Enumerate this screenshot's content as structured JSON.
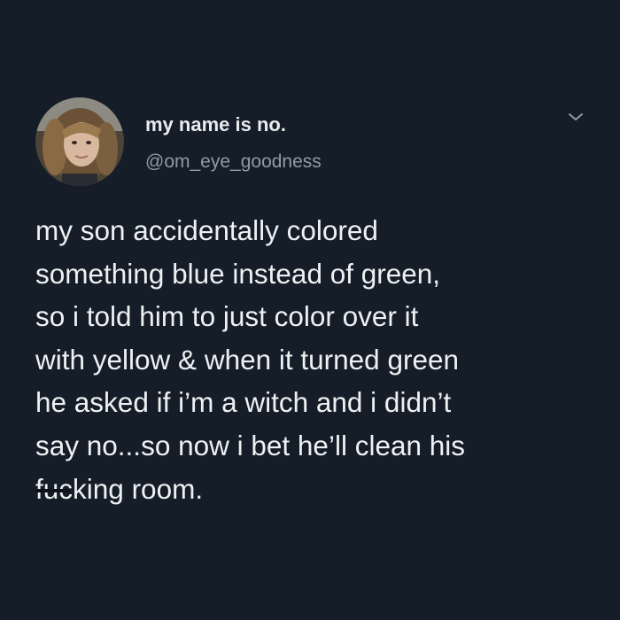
{
  "colors": {
    "background": "#151d28",
    "text_primary": "#eef1f4",
    "text_secondary": "#8f9ba6",
    "chevron": "#8f9ba6"
  },
  "tweet": {
    "author": {
      "display_name": "my name is no.",
      "handle": "@om_eye_goodness",
      "avatar_icon": "profile-photo"
    },
    "menu_icon": "chevron-down-icon",
    "text_lines": [
      "my son accidentally colored",
      "something blue instead of green,",
      "so i told him to just color over it",
      "with yellow & when it turned green",
      "he asked if i’m a witch and i didn’t",
      "say no...so now i bet he’ll clean his"
    ],
    "last_line": {
      "censored_part": "fucking",
      "plain_part": "king room.",
      "censored_display": "fuc"
    }
  }
}
